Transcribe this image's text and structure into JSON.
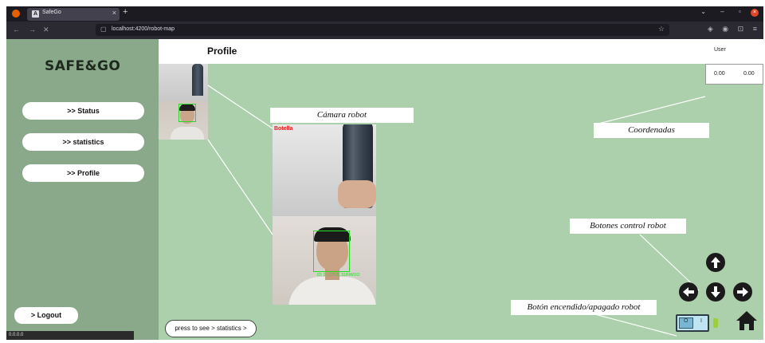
{
  "browser": {
    "tab_title": "SafeGo",
    "tab_favicon": "A",
    "new_tab": "+",
    "url": "localhost:4200/robot-map",
    "nav_back": "←",
    "nav_forward": "→",
    "nav_stop": "✕"
  },
  "sidebar": {
    "logo": "SAFE&GO",
    "items": [
      {
        "label": ">> Status"
      },
      {
        "label": ">> statistics"
      },
      {
        "label": ">> Profile"
      }
    ],
    "logout_label": "> Logout",
    "version": "0.0.0.0"
  },
  "header": {
    "title": "Profile",
    "user": "User"
  },
  "coords": {
    "x": "0.00",
    "y": "0.00"
  },
  "camera": {
    "overlay_label": "Botella",
    "face_tag": "ID: 0 - CHOI, SUNWOO"
  },
  "callouts": {
    "camera": "Cámara robot",
    "coords": "Coordenadas",
    "controls": "Botones control robot",
    "power": "Botón encendido/apagado robot"
  },
  "controls": {
    "up_icon": "arrow-up-icon",
    "left_icon": "arrow-left-icon",
    "down_icon": "arrow-down-icon",
    "right_icon": "arrow-right-icon",
    "home_icon": "home-icon"
  },
  "power_switch": {
    "off_label": "O",
    "on_label": "I",
    "led_color": "#9ccf3a"
  },
  "stats_link": "press to see > statistics >",
  "colors": {
    "sidebar_bg": "#8aa98a",
    "main_bg": "#acd0ac",
    "chrome_bg": "#2b2a33"
  }
}
